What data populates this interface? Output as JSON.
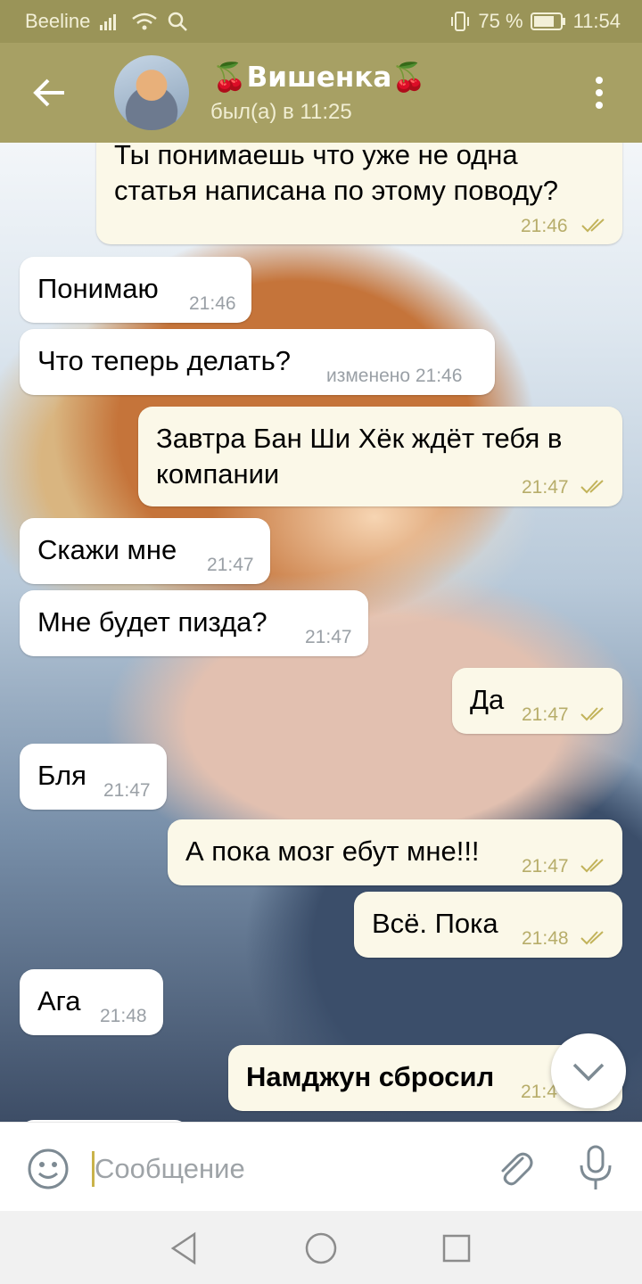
{
  "status_bar": {
    "carrier": "Beeline",
    "battery": "75 %",
    "time": "11:54",
    "icons": [
      "signal-icon",
      "wifi-icon",
      "search-icon",
      "vibrate-icon",
      "battery-icon"
    ]
  },
  "header": {
    "title": "Вишенка",
    "title_emoji": "🍒",
    "subtitle": "был(а) в 11:25",
    "icons": [
      "back-arrow-icon",
      "avatar",
      "more-vert-icon"
    ],
    "accent_color": "#a7a064"
  },
  "messages": [
    {
      "dir": "out",
      "lines": [
        "Ты понимаешь что уже не одна",
        "статья написана по этому поводу?"
      ],
      "time": "21:46",
      "read": true
    },
    {
      "dir": "in",
      "lines": [
        "Понимаю"
      ],
      "time": "21:46"
    },
    {
      "dir": "in",
      "lines": [
        "Что теперь делать?"
      ],
      "time": "изменено 21:46"
    },
    {
      "dir": "out",
      "lines": [
        "Завтра Бан Ши Хёк ждёт тебя в",
        "компании"
      ],
      "time": "21:47",
      "read": true
    },
    {
      "dir": "in",
      "lines": [
        "Скажи мне"
      ],
      "time": "21:47"
    },
    {
      "dir": "in",
      "lines": [
        "Мне будет пизда?"
      ],
      "time": "21:47"
    },
    {
      "dir": "out",
      "lines": [
        "Да"
      ],
      "time": "21:47",
      "read": true
    },
    {
      "dir": "in",
      "lines": [
        "Бля"
      ],
      "time": "21:47"
    },
    {
      "dir": "out",
      "lines": [
        "А пока мозг ебут мне!!!"
      ],
      "time": "21:47",
      "read": true
    },
    {
      "dir": "out",
      "lines": [
        "Всё. Пока"
      ],
      "time": "21:48",
      "read": true
    },
    {
      "dir": "in",
      "lines": [
        "Ага"
      ],
      "time": "21:48"
    },
    {
      "dir": "out",
      "lines": [
        "Намджун сбросил"
      ],
      "time": "21:4",
      "read": true
    }
  ],
  "input": {
    "placeholder": "Сообщение",
    "icons": [
      "emoji-icon",
      "attach-icon",
      "mic-icon"
    ]
  },
  "nav": {
    "icons": [
      "back-triangle-icon",
      "home-circle-icon",
      "recents-square-icon"
    ]
  },
  "scroll_button": {
    "icon": "chevron-down-icon"
  }
}
